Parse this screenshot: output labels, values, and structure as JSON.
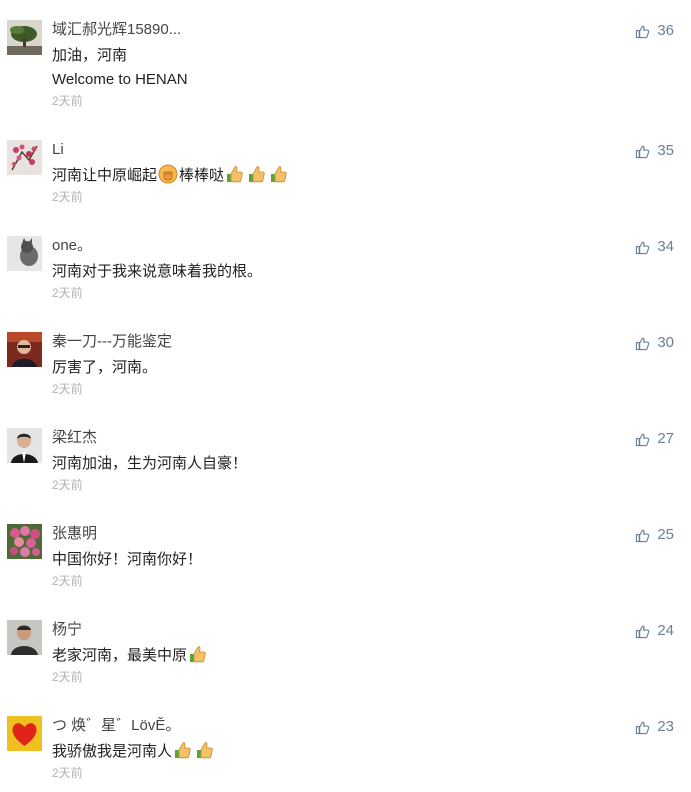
{
  "comments": [
    {
      "name": "域汇郝光辉15890...",
      "lines": [
        "加油，河南",
        "Welcome to HENAN"
      ],
      "time": "2天前",
      "likes": "36"
    },
    {
      "name": "Li",
      "lines": [
        "河南让中原崛起"
      ],
      "tail": "棒棒哒",
      "time": "2天前",
      "likes": "35"
    },
    {
      "name": "one。",
      "lines": [
        "河南对于我来说意味着我的根。"
      ],
      "time": "2天前",
      "likes": "34"
    },
    {
      "name": "秦一刀---万能鉴定",
      "lines": [
        "厉害了，河南。"
      ],
      "time": "2天前",
      "likes": "30"
    },
    {
      "name": "梁红杰",
      "lines": [
        "河南加油，生为河南人自豪！"
      ],
      "time": "2天前",
      "likes": "27"
    },
    {
      "name": "张惠明",
      "lines": [
        "中国你好！河南你好！"
      ],
      "time": "2天前",
      "likes": "25"
    },
    {
      "name": "杨宁",
      "lines": [
        "老家河南，最美中原"
      ],
      "time": "2天前",
      "likes": "24"
    },
    {
      "name": "つ 焕゛星゛LövĚ。",
      "lines": [
        "我骄傲我是河南人"
      ],
      "time": "2天前",
      "likes": "23"
    }
  ],
  "icons": {
    "like": "thumbs-up-outline-icon",
    "emoji_thumb": "thumbs-up-emoji-icon",
    "emoji_fist": "raised-fist-emoji-icon"
  },
  "colors": {
    "like_count": "#6a7f97",
    "name": "#444444",
    "time": "#b3b3b3"
  }
}
